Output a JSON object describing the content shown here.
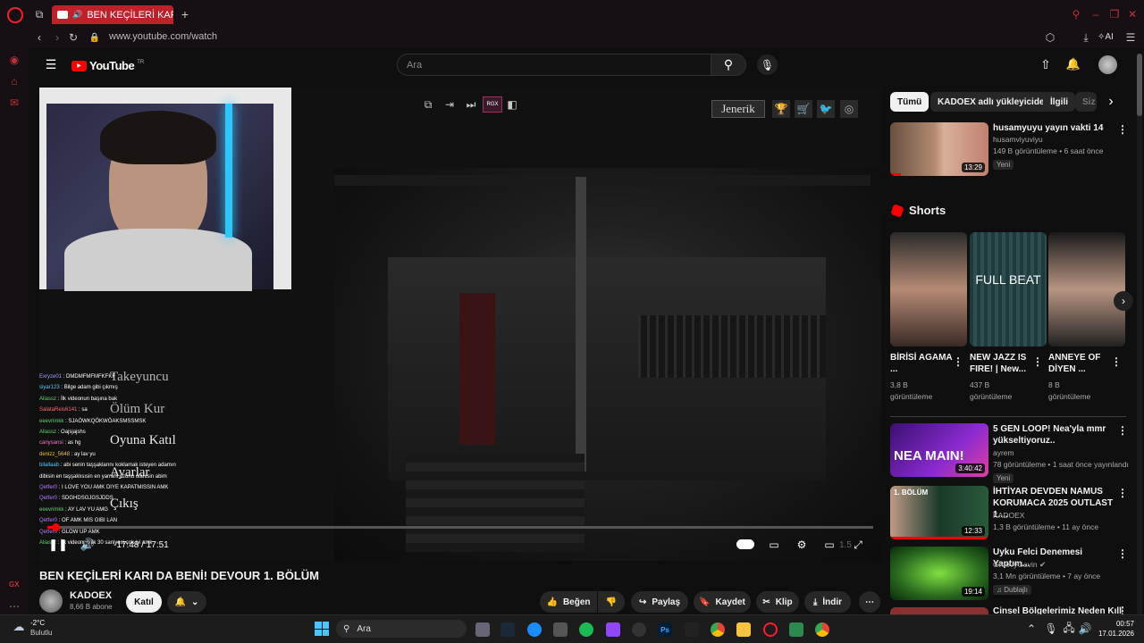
{
  "browser": {
    "tab_title": "BEN KEÇİLERİ KARI DA",
    "url": "www.youtube.com/watch",
    "ai_label": "AI"
  },
  "youtube": {
    "logo": "YouTube",
    "region": "TR",
    "search_placeholder": "Ara"
  },
  "player": {
    "overlay_button_label": "Jenerik",
    "obs_badge": "RGX",
    "time_display": "-17:48 / 17:51",
    "speed": "1.5",
    "progress": 0.01,
    "menu_items": [
      "Takeyuncu",
      "Ölüm Kur",
      "Oyuna Katıl",
      "Ayarlar",
      "Çıkış"
    ]
  },
  "chat": [
    {
      "user": "Exryze01",
      "color": "#a0a0ff",
      "msg": "DMDMFMFMFKFKF"
    },
    {
      "user": "siyar123",
      "color": "#5ac8ff",
      "msg": "Bilge adam gibi çıkmış"
    },
    {
      "user": "Aliassz",
      "color": "#62d26f",
      "msg": "İlk videonun başına bak"
    },
    {
      "user": "SalataReis6141",
      "color": "#ff6b6b",
      "msg": "sa"
    },
    {
      "user": "eeevrimkk",
      "color": "#62d26f",
      "msg": "SJAÖWKQÖKWÖAKSMSSMSK"
    },
    {
      "user": "Aliassz",
      "color": "#62d26f",
      "msg": "Oajsjajshs"
    },
    {
      "user": "canysansi",
      "color": "#ff77cc",
      "msg": "as hg"
    },
    {
      "user": "denizz_5648",
      "color": "#f0c040",
      "msg": "ay lav yu"
    },
    {
      "user": "bilallaab",
      "color": "#5ac8ff",
      "msg": "abi senin taşşaklarını koklamak isteyen adamın"
    },
    {
      "user": "",
      "color": "#ffffff",
      "msg": "dibisin en taşşaklısısin en yarrahi uzunu olanisin abim"
    },
    {
      "user": "Qetfer0",
      "color": "#b27cff",
      "msg": "I LOVE YOU AMK DIYE KAPATMISSIN AMK"
    },
    {
      "user": "Qetfer0",
      "color": "#b27cff",
      "msg": "SDGHDSGJGSJDDS"
    },
    {
      "user": "eeevrimkk",
      "color": "#62d26f",
      "msg": "AY LAV YU AMG"
    },
    {
      "user": "Qetfer0",
      "color": "#b27cff",
      "msg": "OF AMK MIS GIBI LAN"
    },
    {
      "user": "Qetfer0",
      "color": "#b27cff",
      "msg": "GLOW UP AMK"
    },
    {
      "user": "Aliassz",
      "color": "#62d26f",
      "msg": "İlk videonun ilk 30 saniyesi çok iyi amk"
    }
  ],
  "video": {
    "title": "BEN KEÇİLERİ KARI DA BENİ! DEVOUR 1. BÖLÜM",
    "channel": "KADOEX",
    "subscribers": "8,66 B abone",
    "join_label": "Katıl",
    "like_label": "Beğen",
    "share_label": "Paylaş",
    "save_label": "Kaydet",
    "clip_label": "Klip",
    "download_label": "İndir"
  },
  "chips": [
    "Tümü",
    "KADOEX adlı yükleyiciden",
    "İlgili",
    "Siz"
  ],
  "recommendations_top": {
    "title": "husamyuyu yayın vakti 14",
    "channel": "husamviyuviyu",
    "meta": "149 B görüntüleme • 6 saat önce",
    "badge": "Yeni",
    "duration": "13:29"
  },
  "shorts_label": "Shorts",
  "shorts": [
    {
      "title": "BİRİSİ AGAMA ...",
      "views": "3,8 B",
      "views_label": "görüntüleme",
      "overlay": ""
    },
    {
      "title": "NEW JAZZ IS FIRE! | New...",
      "views": "437 B",
      "views_label": "görüntüleme",
      "overlay": "FULL BEAT"
    },
    {
      "title": "ANNEYE OF DİYEN ...",
      "views": "8 B",
      "views_label": "görüntüleme",
      "overlay": ""
    }
  ],
  "recommendations": [
    {
      "title": "5 GEN LOOP! Nea'yla mmr yükseltiyoruz..",
      "channel": "ayrem",
      "meta": "78 görüntüleme • 1 saat önce yayınlandı",
      "badge": "Yeni",
      "duration": "3:40:42",
      "thumb_text": "NEA MAIN!"
    },
    {
      "title": "İHTİYAR DEVDEN NAMUS KORUMACA 2025 OUTLAST 1....",
      "channel": "KADOEX",
      "meta": "1,3 B görüntüleme • 11 ay önce",
      "badge": "",
      "duration": "12:33",
      "thumb_text": "1. BÖLÜM"
    },
    {
      "title": "Uyku Felci Denemesi Yaptım...",
      "channel": "GroovyGavin",
      "meta": "3,1 Mn görüntüleme • 7 ay önce",
      "badge": "Dublajlı",
      "duration": "19:14",
      "thumb_text": ""
    },
    {
      "title": "Cinsel Bölgelerimiz Neden Kıllı?",
      "channel": "",
      "meta": "",
      "badge": "",
      "duration": "",
      "thumb_text": ""
    }
  ],
  "taskbar": {
    "temp": "-2°C",
    "weather": "Bulutlu",
    "search": "Ara",
    "time": "00:57",
    "date": "17.01.2026"
  },
  "colors": {
    "accent": "#ff0000",
    "opera": "#ff1b2d",
    "bg": "#0f0f0f"
  }
}
